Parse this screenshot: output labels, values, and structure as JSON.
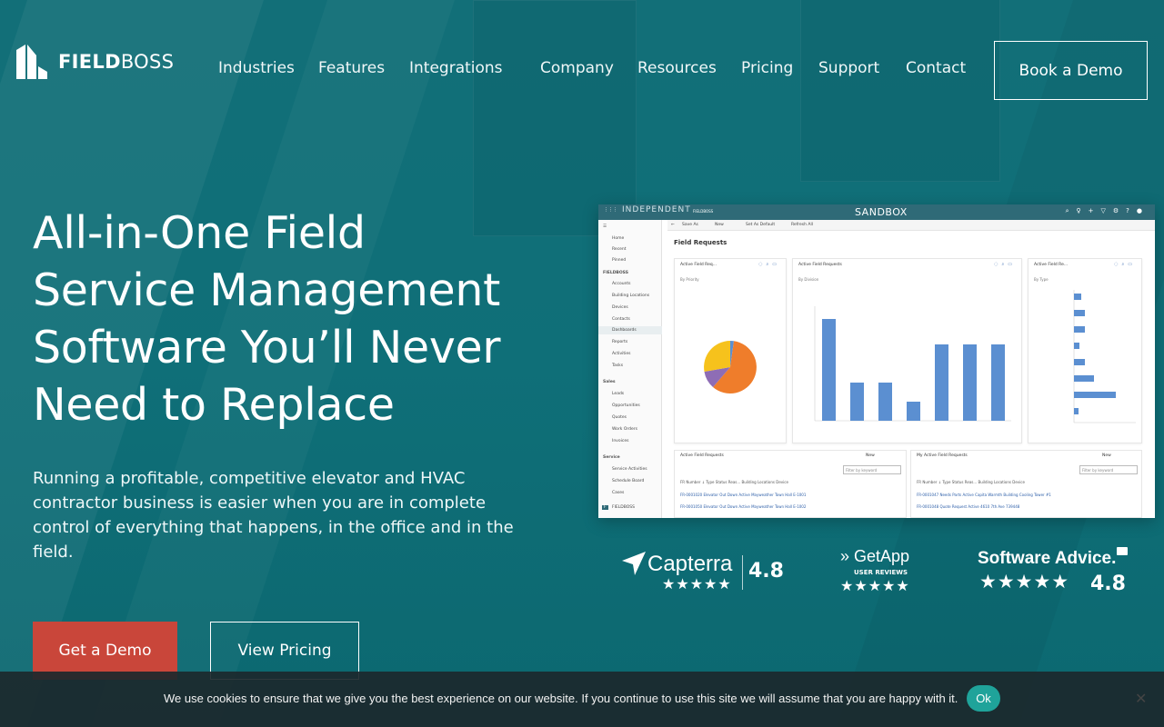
{
  "brand": {
    "name_bold": "FIELD",
    "name_light": "BOSS"
  },
  "nav": {
    "items": [
      "Industries",
      "Features",
      "Integrations",
      "Company",
      "Resources",
      "Pricing",
      "Support",
      "Contact"
    ],
    "cta": "Book a Demo"
  },
  "hero": {
    "headline_lines": [
      "All-in-One Field",
      "Service Management",
      "Software You’ll Never",
      "Need to Replace"
    ],
    "subcopy": "Running a profitable, competitive elevator and HVAC contractor business is easier when you are in complete control of everything that happens, in the office and in the field.",
    "primary_cta": "Get a Demo",
    "secondary_cta": "View Pricing"
  },
  "app_screenshot": {
    "org": "INDEPENDENT",
    "product": "FIELDBOSS",
    "env": "SANDBOX",
    "commands": [
      "Save As",
      "New",
      "Set As Default",
      "Refresh All"
    ],
    "sidebar": {
      "top": [
        "Home",
        "Recent",
        "Pinned"
      ],
      "section1": "FIELDBOSS",
      "items1": [
        "Accounts",
        "Building Locations",
        "Devices",
        "Contacts",
        "Dashboards",
        "Reports",
        "Activities",
        "Tasks"
      ],
      "section2": "Sales",
      "items2": [
        "Leads",
        "Opportunities",
        "Quotes",
        "Work Orders",
        "Invoices"
      ],
      "section3": "Service",
      "items3": [
        "Service Activities",
        "Schedule Board",
        "Cases"
      ],
      "footer": "FIELDBOSS"
    },
    "page_title": "Field Requests",
    "cards": [
      {
        "title": "Active Field Req...",
        "subtitle": "By Priority"
      },
      {
        "title": "Active Field Requests",
        "subtitle": "By Division"
      },
      {
        "title": "Active Field Re...",
        "subtitle": "By Type"
      }
    ],
    "tables": [
      {
        "title": "Active Field Requests",
        "new": "New",
        "filter": "Filter by keyword",
        "headers": "FR Number ↓   Type   Status Reas...   Building Locations   Device",
        "rows": [
          "FR-0001020   Elevator Out Down   Active   Mayweather Town Hall   E-1001",
          "FR-0001050   Elevator Out Down   Active   Mayweather Town Hall   E-1002"
        ]
      },
      {
        "title": "My Active Field Requests",
        "new": "New",
        "filter": "Filter by keyword",
        "headers": "FR Number ↓   Type   Status Reas...   Building Locations   Device",
        "rows": [
          "FR-0001047   Needs Parts   Active   Capita Warmth Building   Cooling Tower #1",
          "FR-0001048   Quote Request   Active   4610 7th Ave   739448"
        ]
      }
    ]
  },
  "reviews": [
    {
      "name": "Capterra",
      "rating": "4.8",
      "stars": "★★★★★"
    },
    {
      "name": "GetApp",
      "tag": "USER REVIEWS",
      "stars": "★★★★★"
    },
    {
      "name": "Software Advice.",
      "rating": "4.8",
      "stars": "★★★★★"
    }
  ],
  "cookie": {
    "text": "We use cookies to ensure that we give you the best experience on our website. If you continue to use this site we will assume that you are happy with it.",
    "ok": "Ok",
    "close": "✕"
  },
  "colors": {
    "primary_cta": "#c9463a",
    "teal_bg": "#0e6b74",
    "cookie_ok": "#1fa39a",
    "chart_blue": "#5b8fd1",
    "chart_orange": "#ef7d2b",
    "chart_yellow": "#f6c21c",
    "chart_purple": "#8e6db5"
  }
}
